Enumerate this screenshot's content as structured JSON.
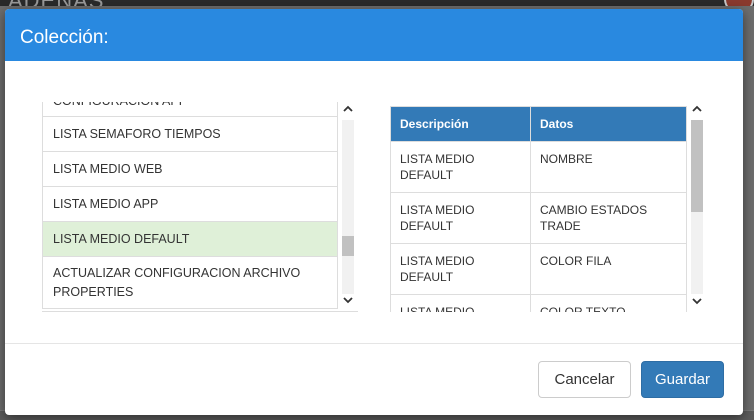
{
  "background": {
    "app_title": "ADENAS"
  },
  "modal": {
    "title": "Colección:",
    "list": {
      "items": [
        {
          "label": "CONFIGURACION APP"
        },
        {
          "label": "LISTA SEMAFORO TIEMPOS"
        },
        {
          "label": "LISTA MEDIO WEB"
        },
        {
          "label": "LISTA MEDIO APP"
        },
        {
          "label": "LISTA MEDIO DEFAULT",
          "selected": true
        },
        {
          "label": "ACTUALIZAR CONFIGURACION ARCHIVO PROPERTIES"
        }
      ]
    },
    "table": {
      "columns": [
        "Descripción",
        "Datos"
      ],
      "rows": [
        [
          "LISTA MEDIO DEFAULT",
          "NOMBRE"
        ],
        [
          "LISTA MEDIO DEFAULT",
          "CAMBIO ESTADOS TRADE"
        ],
        [
          "LISTA MEDIO DEFAULT",
          "COLOR FILA"
        ],
        [
          "LISTA MEDIO",
          "COLOR TEXTO"
        ]
      ]
    },
    "footer": {
      "cancel_label": "Cancelar",
      "save_label": "Guardar"
    }
  },
  "colors": {
    "header": "#2989e0",
    "primary": "#337ab7",
    "selected_row": "#dff0d8"
  },
  "icons": {
    "scroll_up": "chevron-up-icon",
    "scroll_down": "chevron-down-icon"
  }
}
